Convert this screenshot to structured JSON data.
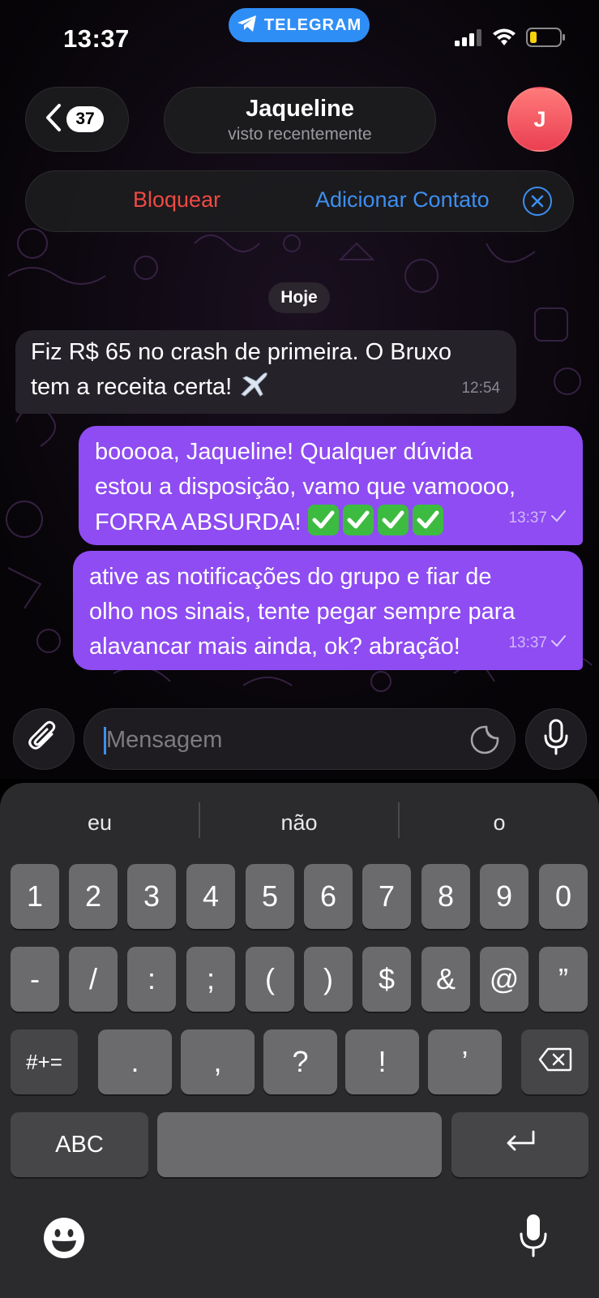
{
  "status_bar": {
    "time": "13:37",
    "app_pill": "TELEGRAM"
  },
  "header": {
    "unread_count": "37",
    "contact_name": "Jaqueline",
    "contact_status": "visto recentemente",
    "avatar_initial": "J"
  },
  "actions": {
    "block_label": "Bloquear",
    "add_contact_label": "Adicionar Contato"
  },
  "date_chip": "Hoje",
  "messages": [
    {
      "direction": "incoming",
      "line1": "Fiz R$ 65 no crash de primeira. O Bruxo",
      "line2": "tem a receita certa!",
      "time": "12:54"
    },
    {
      "direction": "outgoing",
      "line1": "booooa, Jaqueline! Qualquer dúvida",
      "line2": "estou a disposição, vamo que vamoooo,",
      "line3": "FORRA ABSURDA!",
      "time": "13:37"
    },
    {
      "direction": "outgoing",
      "line1": "ative as notificações do grupo e fiar de",
      "line2": "olho nos sinais, tente pegar sempre para",
      "line3": "alavancar mais ainda, ok? abração!",
      "time": "13:37"
    }
  ],
  "composer": {
    "placeholder": "Mensagem"
  },
  "keyboard": {
    "suggestions": [
      "eu",
      "não",
      "o"
    ],
    "row1": [
      "1",
      "2",
      "3",
      "4",
      "5",
      "6",
      "7",
      "8",
      "9",
      "0"
    ],
    "row2": [
      "-",
      "/",
      ":",
      ";",
      "(",
      ")",
      "$",
      "&",
      "@",
      "”"
    ],
    "row3": [
      "#+=",
      ".",
      ",",
      "?",
      "!",
      "’"
    ],
    "abc_label": "ABC"
  },
  "colors": {
    "outgoing_bubble": "#8e4cf2",
    "incoming_bubble": "#26222a",
    "accent_blue": "#3d8ff0",
    "danger_red": "#ee4a44",
    "telegram_blue": "#2f8ef5"
  }
}
